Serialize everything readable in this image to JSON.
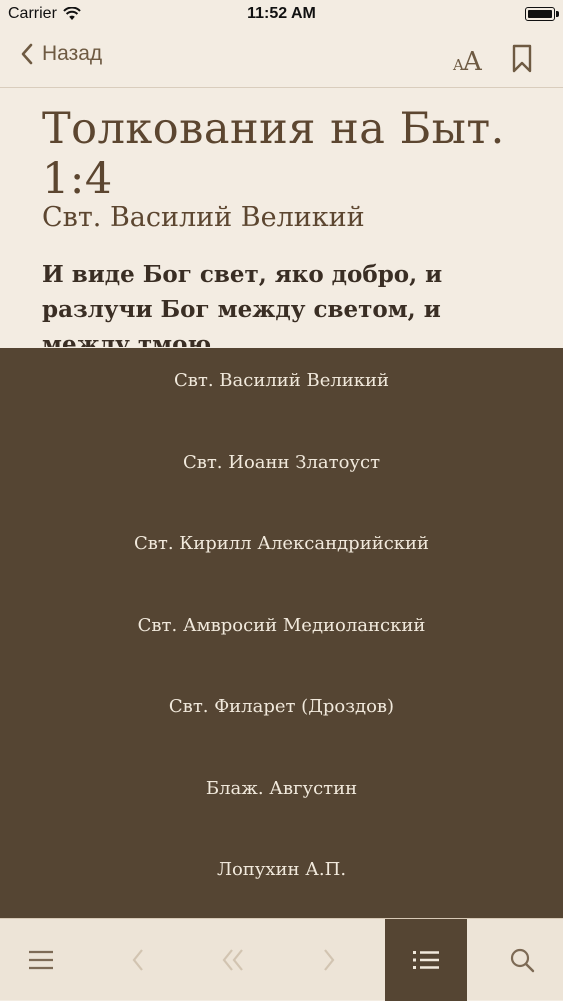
{
  "status_bar": {
    "carrier": "Carrier",
    "time": "11:52 AM"
  },
  "nav": {
    "back_label": "Назад"
  },
  "page": {
    "title": "Толкования на Быт. 1:4",
    "author": "Свт. Василий Великий",
    "verse": "И виде Бог свет, яко добро, и разлучи Бог между светом, и между тмою"
  },
  "author_menu": {
    "items": [
      {
        "label": "Свт. Василий Великий"
      },
      {
        "label": "Свт. Иоанн Златоуст"
      },
      {
        "label": "Свт. Кирилл Александрийский"
      },
      {
        "label": "Свт. Амвросий Медиоланский"
      },
      {
        "label": "Свт. Филарет (Дроздов)"
      },
      {
        "label": "Блаж. Августин"
      },
      {
        "label": "Лопухин А.П."
      }
    ]
  },
  "tab_bar": {
    "icons": [
      "menu-icon",
      "prev-chapter-icon",
      "first-chapter-icon",
      "next-chapter-icon",
      "commentary-list-icon",
      "search-icon"
    ],
    "active": "commentary-list-icon"
  },
  "colors": {
    "background": "#f3ece2",
    "menu_background": "#554533",
    "menu_text": "#f1e9dc",
    "title": "#5c4630",
    "icon": "#7d6a55",
    "disabled_icon": "#d2c4b1"
  }
}
